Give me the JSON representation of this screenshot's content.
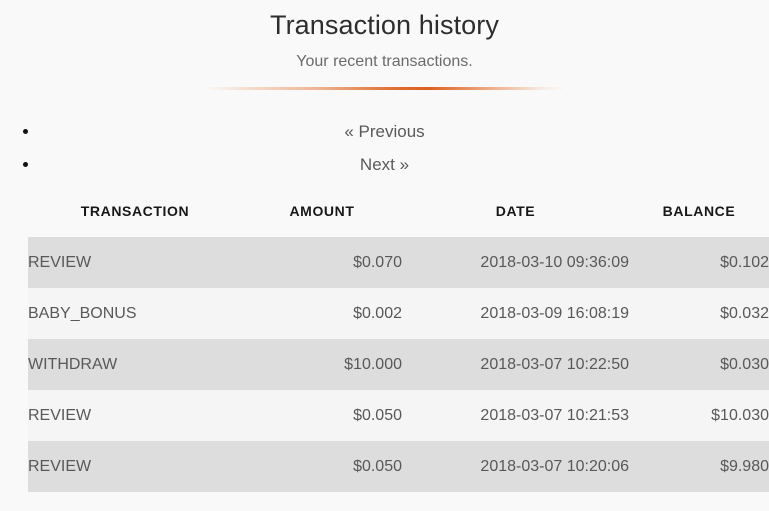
{
  "header": {
    "title": "Transaction history",
    "subtitle": "Your recent transactions."
  },
  "colors": {
    "page_background": "#f9f9f9",
    "accent_rule": "#db5811",
    "row_odd": "#dddddd",
    "row_even": "#f5f5f5",
    "title_text": "#2d2d2d",
    "subtitle_text": "#6b6b6b",
    "cell_text": "#585858",
    "header_text": "#181818"
  },
  "pagination": {
    "previous_label": "« Previous",
    "next_label": "Next »"
  },
  "table": {
    "columns": [
      {
        "key": "transaction",
        "label": "TRANSACTION"
      },
      {
        "key": "amount",
        "label": "AMOUNT"
      },
      {
        "key": "date",
        "label": "DATE"
      },
      {
        "key": "balance",
        "label": "BALANCE"
      }
    ],
    "rows": [
      {
        "transaction": "REVIEW",
        "amount": "$0.070",
        "date": "2018-03-10 09:36:09",
        "balance": "$0.102"
      },
      {
        "transaction": "BABY_BONUS",
        "amount": "$0.002",
        "date": "2018-03-09 16:08:19",
        "balance": "$0.032"
      },
      {
        "transaction": "WITHDRAW",
        "amount": "$10.000",
        "date": "2018-03-07 10:22:50",
        "balance": "$0.030"
      },
      {
        "transaction": "REVIEW",
        "amount": "$0.050",
        "date": "2018-03-07 10:21:53",
        "balance": "$10.030"
      },
      {
        "transaction": "REVIEW",
        "amount": "$0.050",
        "date": "2018-03-07 10:20:06",
        "balance": "$9.980"
      }
    ]
  }
}
